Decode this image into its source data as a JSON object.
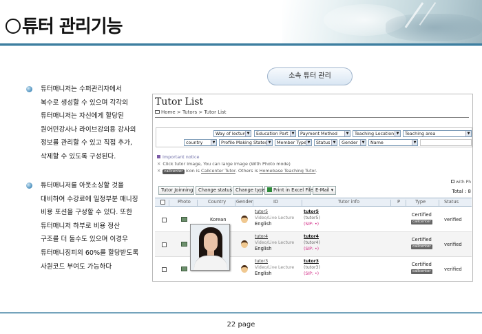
{
  "slide": {
    "title": "튜터 관리기능",
    "pill_label": "소속 튜터 관리",
    "bullets": [
      "튜터매니저는 수퍼관리자에서 복수로 생성할 수 있으며 각각의 튜터매니저는 자신에게 할당된 원어민강사나 라이브강의용 강사의 정보를 관리할 수 있고 직접 추가, 삭제할 수 있도록 구성된다.",
      "튜터매니저를 아웃소싱할 것을 대비하여 수강료에 일정부분 매니징 비용 포션을 구성할 수 있다. 또한 튜터매니저 하부로 비용 정산 구조를 더 둘수도 있으며 이경우 튜터매니징피의 60%를 할당받도록 사원코드 부여도 가능하다"
    ],
    "page_label": "22 page"
  },
  "app": {
    "title": "Tutor List",
    "breadcrumb": "Home > Tutors > Tutor List",
    "filters_row1": [
      "Way of lecture",
      "Education Part",
      "Payment Method",
      "Teaching Location",
      "Teaching area"
    ],
    "filters_row2": [
      "country",
      "Profile Making States",
      "Member Type",
      "Status",
      "Gender",
      "Name"
    ],
    "notice": {
      "heading": "Important notice",
      "line1": "Click tutor image, You can large image (With Photo mode)",
      "line2_tag": "callcenter",
      "line2_pre": "icon is",
      "line2_link1": "Callcenter Tutor",
      "line2_mid": ". Others is",
      "line2_link2": "Homebase Teaching Tutor",
      "line2_end": "."
    },
    "with_photo": "with Ph",
    "total": "Total : 8",
    "toolbar": {
      "joinning": "Tutor Joinning",
      "change_status": "Change status",
      "change_type": "Change type",
      "print_excel": "Print in Excel File",
      "email": "E-Mail"
    },
    "columns": [
      "Photo",
      "Country",
      "Gender",
      "ID",
      "Tutor info",
      "P",
      "Type",
      "Status"
    ],
    "rows": [
      {
        "country": "Korean",
        "id": "tutor5",
        "course": "Video/Live Lecture",
        "lang": "English",
        "info_name": "tutor5",
        "info_id": "(tutor5)",
        "sip": "(SIP: •)",
        "type": "Certified",
        "tag": "callcenter",
        "status": "verified"
      },
      {
        "country": "",
        "id": "tutor4",
        "course": "Video/Live Lecture",
        "lang": "English",
        "info_name": "tutor4",
        "info_id": "(tutor4)",
        "sip": "(SIP: •)",
        "type": "Certified",
        "tag": "callcenter",
        "status": "verified"
      },
      {
        "country": "",
        "id": "tutor3",
        "course": "Video/Live Lecture",
        "lang": "English",
        "info_name": "tutor3",
        "info_id": "(tutor3)",
        "sip": "(SIP: •)",
        "type": "Certified",
        "tag": "callcenter",
        "status": "verified"
      }
    ]
  }
}
